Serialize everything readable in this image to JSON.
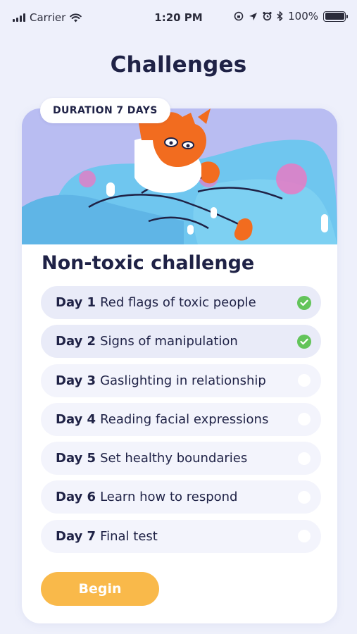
{
  "status_bar": {
    "carrier": "Carrier",
    "time": "1:20 PM",
    "battery": "100%",
    "icons": [
      "signal-icon",
      "wifi-icon",
      "lock-rotation-icon",
      "location-icon",
      "alarm-icon",
      "bluetooth-icon",
      "battery-icon"
    ]
  },
  "page": {
    "title": "Challenges"
  },
  "card": {
    "duration_label": "DURATION 7 DAYS",
    "hero_icon": "cat-illustration",
    "title": "Non-toxic challenge",
    "days": [
      {
        "num": "Day 1",
        "label": "Red flags of toxic people",
        "done": true
      },
      {
        "num": "Day 2",
        "label": "Signs of manipulation",
        "done": true
      },
      {
        "num": "Day 3",
        "label": "Gaslighting in relationship",
        "done": false
      },
      {
        "num": "Day 4",
        "label": "Reading facial expressions",
        "done": false
      },
      {
        "num": "Day 5",
        "label": "Set healthy boundaries",
        "done": false
      },
      {
        "num": "Day 6",
        "label": "Learn how to respond",
        "done": false
      },
      {
        "num": "Day 7",
        "label": "Final test",
        "done": false
      }
    ],
    "begin_label": "Begin"
  },
  "colors": {
    "background": "#eef0fb",
    "text": "#1f2246",
    "accent": "#f9b94a",
    "check": "#63c45a",
    "hero_bg": "#b9bdf2"
  }
}
